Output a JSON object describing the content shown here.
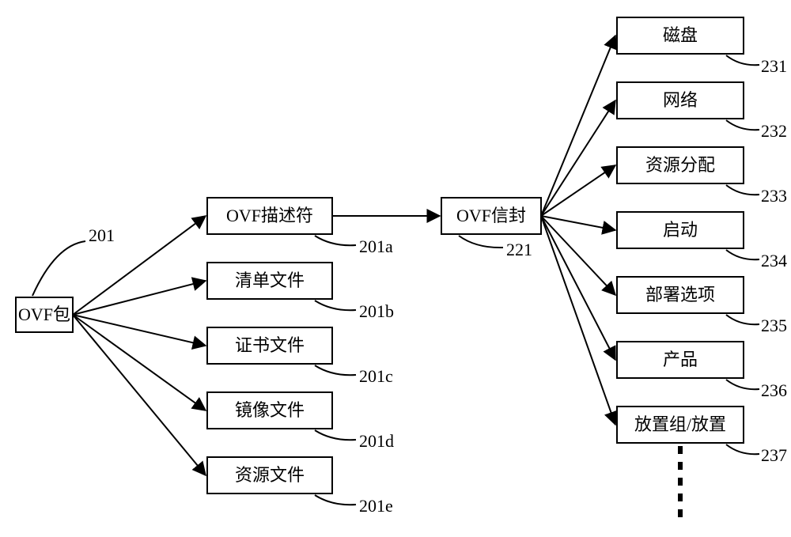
{
  "root": {
    "label": "OVF包",
    "ref": "201"
  },
  "level2": [
    {
      "label": "OVF描述符",
      "ref": "201a"
    },
    {
      "label": "清单文件",
      "ref": "201b"
    },
    {
      "label": "证书文件",
      "ref": "201c"
    },
    {
      "label": "镜像文件",
      "ref": "201d"
    },
    {
      "label": "资源文件",
      "ref": "201e"
    }
  ],
  "envelope": {
    "label": "OVF信封",
    "ref": "221"
  },
  "level3": [
    {
      "label": "磁盘",
      "ref": "231"
    },
    {
      "label": "网络",
      "ref": "232"
    },
    {
      "label": "资源分配",
      "ref": "233"
    },
    {
      "label": "启动",
      "ref": "234"
    },
    {
      "label": "部署选项",
      "ref": "235"
    },
    {
      "label": "产品",
      "ref": "236"
    },
    {
      "label": "放置组/放置",
      "ref": "237"
    }
  ]
}
